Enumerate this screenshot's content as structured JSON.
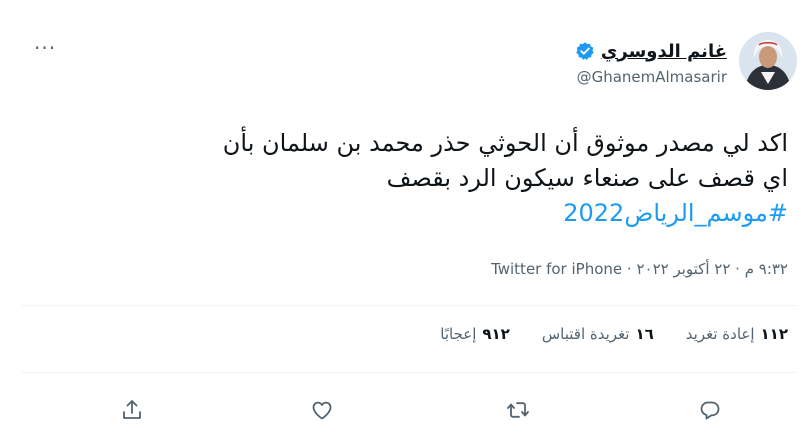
{
  "author": {
    "name": "غانم الدوسري",
    "handle": "@GhanemAlmasarir"
  },
  "tweet": {
    "line1": "اكد لي مصدر موثوق أن الحوثي حذر محمد بن سلمان بأن",
    "line2": "اي قصف على صنعاء سيكون الرد بقصف",
    "hashtag": "#موسم_الرياض2022"
  },
  "meta": {
    "time": "٩:٣٢ م",
    "separator": " · ",
    "date": "٢٢ أكتوبر ٢٠٢٢",
    "source": "Twitter for iPhone"
  },
  "stats": {
    "retweets_count": "١١٢",
    "retweets_label": "إعادة تغريد",
    "quotes_count": "١٦",
    "quotes_label": "تغريدة اقتباس",
    "likes_count": "٩١٢",
    "likes_label": "إعجابًا"
  },
  "more_label": "···",
  "colors": {
    "accent": "#1d9bf0",
    "text": "#0f1419",
    "secondary": "#536471",
    "divider": "#eff3f4"
  },
  "icons": [
    "verified-badge-icon",
    "more-icon",
    "share-icon",
    "like-icon",
    "retweet-icon",
    "reply-icon"
  ]
}
